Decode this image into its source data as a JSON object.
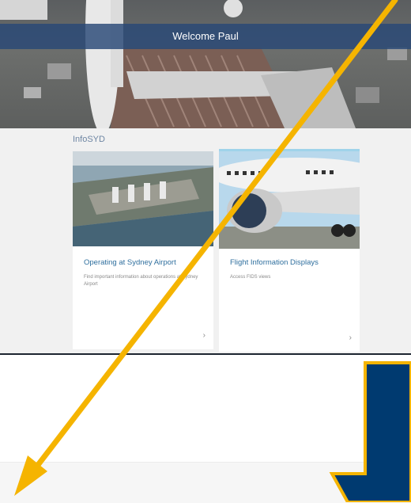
{
  "hero": {
    "welcome_text": "Welcome Paul"
  },
  "section": {
    "title": "InfoSYD"
  },
  "cards": [
    {
      "title": "Operating at Sydney Airport",
      "description": "Find important information about operations at Sydney Airport",
      "chevron": "›",
      "image_icon": "airport-aerial-image"
    },
    {
      "title": "Flight Information Displays",
      "description": "Access FIDS views",
      "chevron": "›",
      "image_icon": "aircraft-engine-image"
    }
  ],
  "colors": {
    "banner": "#284876",
    "accent_title": "#2f6f9e",
    "arrow_yellow": "#f5b400",
    "arrow_navy": "#003a70"
  }
}
